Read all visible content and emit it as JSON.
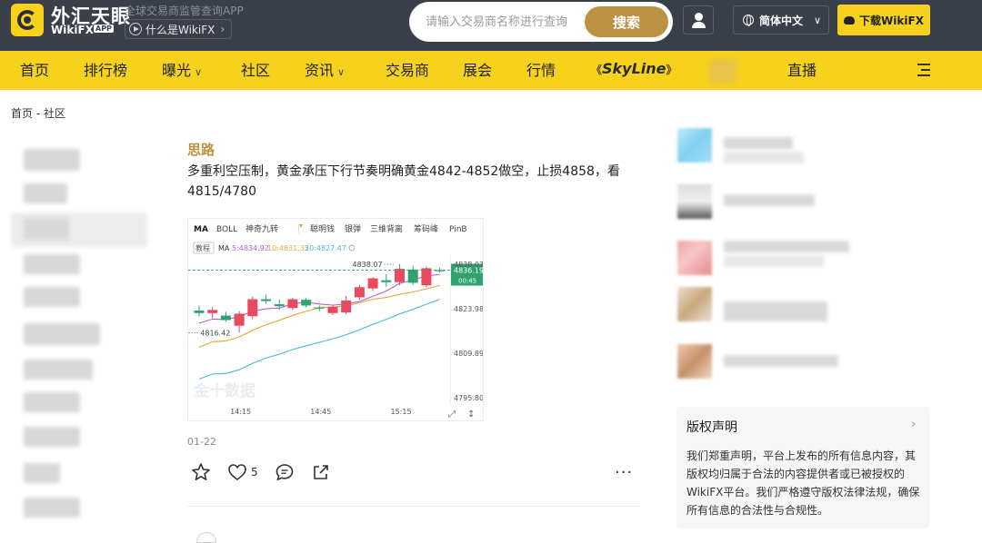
{
  "header": {
    "brand_cn": "外汇天眼",
    "brand_en": "WikiFX",
    "brand_app": "APP",
    "tagline": "全球交易商监管查询APP",
    "what_is": "什么是WikiFX",
    "search_placeholder": "请输入交易商名称进行查询",
    "search_button": "搜索",
    "language": "简体中文",
    "download": "下载WikiFX"
  },
  "nav": {
    "items": [
      "首页",
      "排行榜",
      "曝光",
      "社区",
      "资讯",
      "交易商",
      "展会",
      "行情"
    ],
    "skyline": "SkyLine",
    "live": "直播"
  },
  "breadcrumb": "首页 - 社区",
  "post": {
    "author": "思路",
    "text": "多重利空压制，黄金承压下行节奏明确黄金4842-4852做空，止损4858，看4815/4780",
    "date": "01-22",
    "likes": "5"
  },
  "chart_data": {
    "type": "candlestick",
    "toolbar": [
      "MA",
      "BOLL",
      "神奇九转",
      "聪明钱",
      "银弹",
      "三维背离",
      "筹码峰",
      "PinB"
    ],
    "tutorial_badge": "教程",
    "ma_label": "MA",
    "ma_values": [
      "5:4834.92",
      "10:4831.35",
      "20:4827.47"
    ],
    "price_ticks": [
      "4838.07",
      "4823.98",
      "4809.89",
      "4795.80"
    ],
    "current_price": "4836.19",
    "countdown": "00:45",
    "high_annotation": "4838.07",
    "low_annotation": "4816.42",
    "time_ticks": [
      "14:15",
      "14:45",
      "15:15"
    ],
    "watermark": "金十数据",
    "ylim": [
      4795.8,
      4838.07
    ],
    "candles": [
      {
        "o": 4823.4,
        "h": 4825.0,
        "l": 4821.5,
        "c": 4822.6
      },
      {
        "o": 4822.6,
        "h": 4824.5,
        "l": 4821.0,
        "c": 4823.6
      },
      {
        "o": 4821.8,
        "h": 4823.0,
        "l": 4819.8,
        "c": 4820.4
      },
      {
        "o": 4818.6,
        "h": 4823.2,
        "l": 4816.4,
        "c": 4822.4
      },
      {
        "o": 4821.6,
        "h": 4827.8,
        "l": 4820.6,
        "c": 4827.0
      },
      {
        "o": 4827.0,
        "h": 4828.4,
        "l": 4825.6,
        "c": 4826.4
      },
      {
        "o": 4825.4,
        "h": 4826.8,
        "l": 4823.6,
        "c": 4824.8
      },
      {
        "o": 4824.2,
        "h": 4827.4,
        "l": 4823.6,
        "c": 4827.0
      },
      {
        "o": 4826.8,
        "h": 4827.4,
        "l": 4824.4,
        "c": 4825.0
      },
      {
        "o": 4824.4,
        "h": 4825.0,
        "l": 4823.2,
        "c": 4824.2
      },
      {
        "o": 4822.6,
        "h": 4825.0,
        "l": 4822.0,
        "c": 4824.6
      },
      {
        "o": 4822.8,
        "h": 4828.0,
        "l": 4822.2,
        "c": 4826.6
      },
      {
        "o": 4827.6,
        "h": 4831.6,
        "l": 4826.8,
        "c": 4830.8
      },
      {
        "o": 4830.4,
        "h": 4834.0,
        "l": 4829.6,
        "c": 4833.6
      },
      {
        "o": 4833.0,
        "h": 4835.0,
        "l": 4831.0,
        "c": 4832.4
      },
      {
        "o": 4832.4,
        "h": 4838.07,
        "l": 4831.4,
        "c": 4836.6
      },
      {
        "o": 4836.4,
        "h": 4837.6,
        "l": 4831.6,
        "c": 4832.2
      },
      {
        "o": 4831.4,
        "h": 4837.4,
        "l": 4830.8,
        "c": 4836.8
      },
      {
        "o": 4836.2,
        "h": 4837.0,
        "l": 4835.4,
        "c": 4836.19
      }
    ],
    "colors": {
      "up": "#e84a5f",
      "down": "#2ea36b",
      "ma5": "#b65fd0",
      "ma10": "#e6a53a",
      "ma20": "#49b8d8",
      "price_tag": "#2ea36b"
    }
  },
  "right": {
    "copyright_title": "版权声明",
    "copyright_body": "我们郑重声明，平台上发布的所有信息内容，其版权均归属于合法的内容提供者或已被授权的WikiFX平台。我们严格遵守版权法律法规，确保所有信息的合法性与合规性。"
  },
  "colors": {
    "header_bg": "#3b3f4a",
    "nav_bg": "#f6d21c",
    "accent_gold": "#bd9142",
    "download_bg": "#f6d21c"
  }
}
